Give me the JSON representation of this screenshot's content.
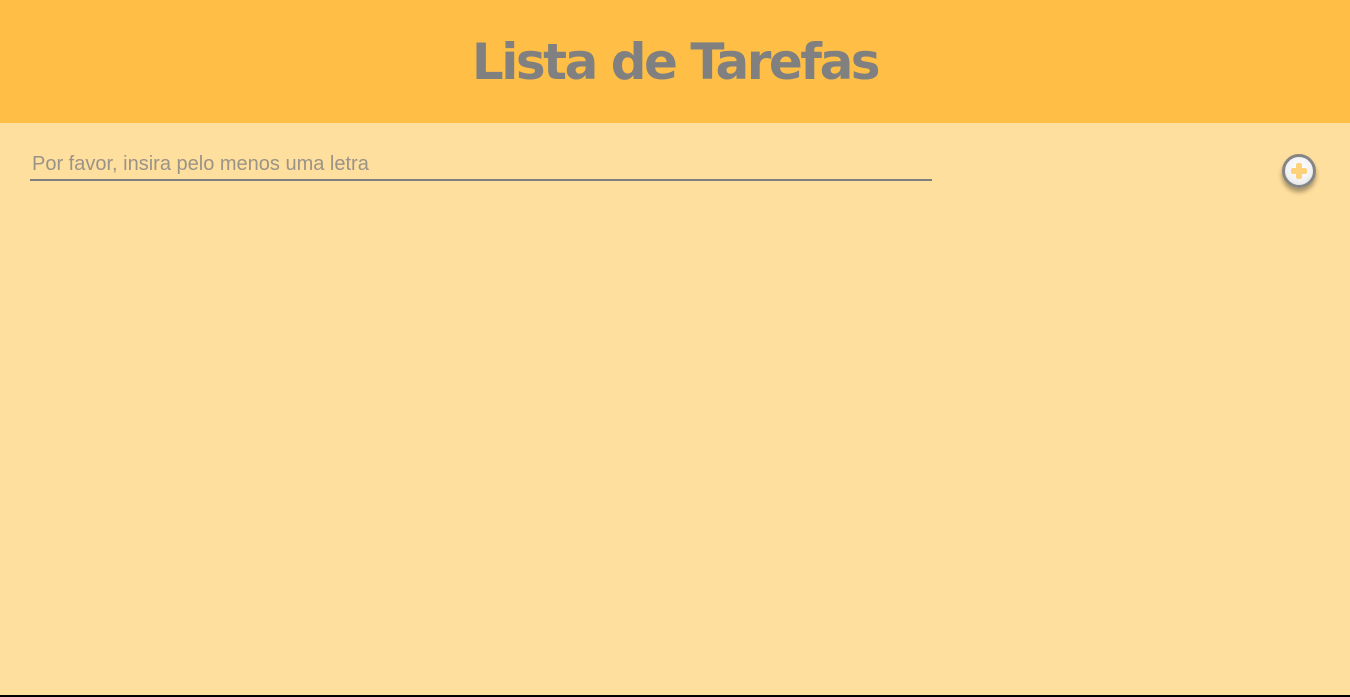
{
  "header": {
    "title": "Lista de Tarefas"
  },
  "form": {
    "input_value": "",
    "input_placeholder": "Por favor, insira pelo menos uma letra",
    "add_button_icon": "plus-icon"
  },
  "tasks": [],
  "colors": {
    "header_background": "#ffbf47",
    "page_background": "#ffdf9e",
    "title_text": "#808080",
    "input_underline": "#7f7f7f",
    "plus_icon": "#ffd27a"
  }
}
